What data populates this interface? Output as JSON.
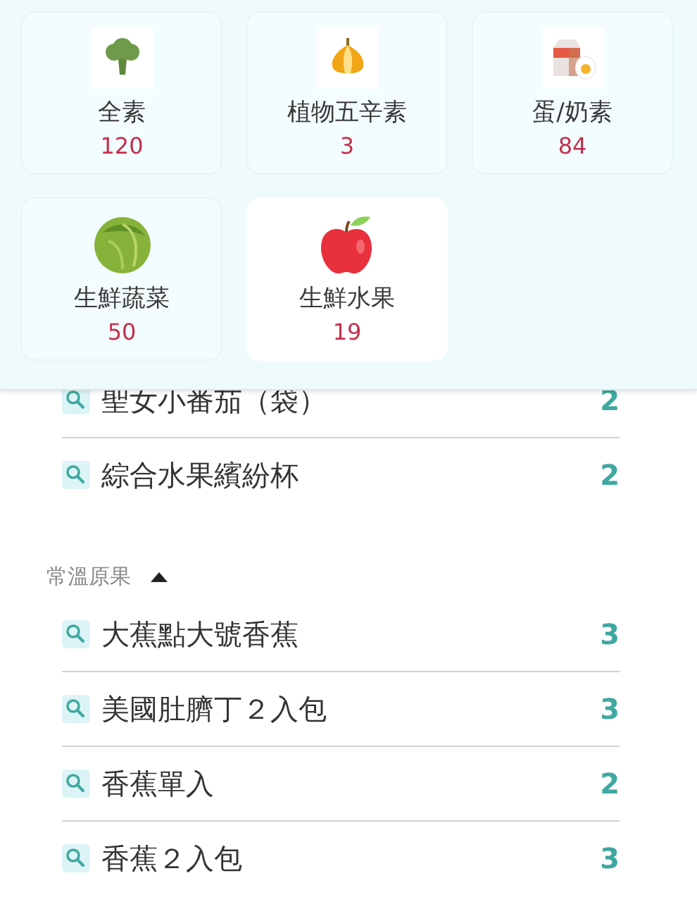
{
  "categories": [
    {
      "kind": "broccoli",
      "label": "全素",
      "count": "120",
      "selected": false
    },
    {
      "kind": "onion",
      "label": "植物五辛素",
      "count": "3",
      "selected": false
    },
    {
      "kind": "milk-egg",
      "label": "蛋/奶素",
      "count": "84",
      "selected": false
    },
    {
      "kind": "cabbage",
      "label": "生鮮蔬菜",
      "count": "50",
      "selected": false
    },
    {
      "kind": "apple",
      "label": "生鮮水果",
      "count": "19",
      "selected": true
    }
  ],
  "sections": [
    {
      "items": [
        {
          "name": "聖女小番茄（袋）",
          "count": "2"
        },
        {
          "name": "綜合水果繽紛杯",
          "count": "2"
        }
      ]
    },
    {
      "title": "常溫原果",
      "expanded": true,
      "items": [
        {
          "name": "大蕉點大號香蕉",
          "count": "3"
        },
        {
          "name": "美國肚臍丁２入包",
          "count": "3"
        },
        {
          "name": "香蕉單入",
          "count": "2"
        },
        {
          "name": "香蕉２入包",
          "count": "3"
        }
      ]
    }
  ]
}
